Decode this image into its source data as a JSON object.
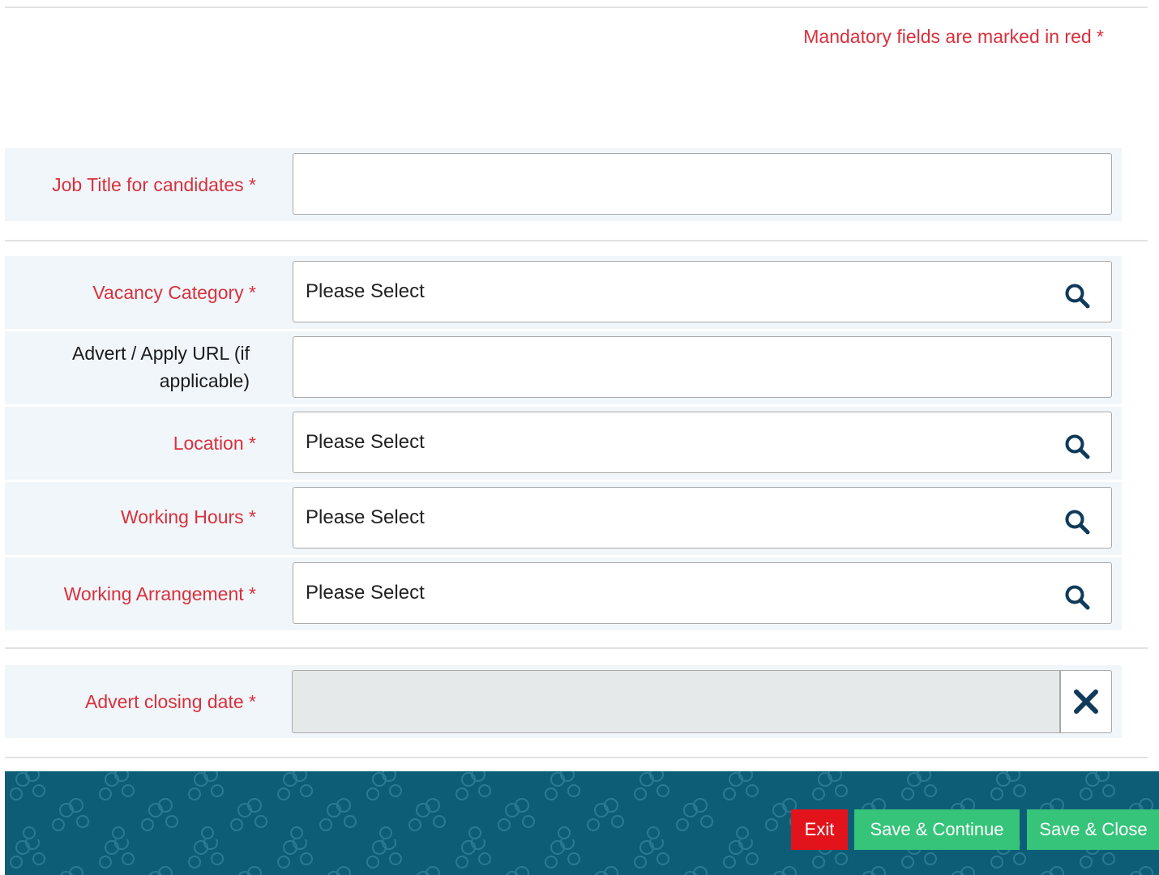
{
  "header": {
    "mandatory_note": "Mandatory fields are marked in red *"
  },
  "form": {
    "job_title": {
      "label": "Job Title for candidates *",
      "value": ""
    },
    "vacancy_category": {
      "label": "Vacancy Category *",
      "value": "Please Select"
    },
    "advert_url": {
      "label_line1": "Advert / Apply URL (if",
      "label_line2": "applicable)",
      "value": ""
    },
    "location": {
      "label": "Location *",
      "value": "Please Select"
    },
    "working_hours": {
      "label": "Working Hours *",
      "value": "Please Select"
    },
    "working_arrangement": {
      "label": "Working Arrangement *",
      "value": "Please Select"
    },
    "advert_closing_date": {
      "label": "Advert closing date *",
      "value": ""
    }
  },
  "icons": {
    "lookup": "search-icon",
    "clear": "close-icon"
  },
  "footer": {
    "exit_label": "Exit",
    "save_continue_label": "Save & Continue",
    "save_close_label": "Save & Close"
  },
  "colors": {
    "mandatory_red": "#d9303c",
    "row_background": "#f1f6fa",
    "footer_teal": "#0d5d77",
    "exit_red": "#e3131b",
    "save_green": "#35c47a",
    "icon_navy": "#0f3a5a"
  }
}
